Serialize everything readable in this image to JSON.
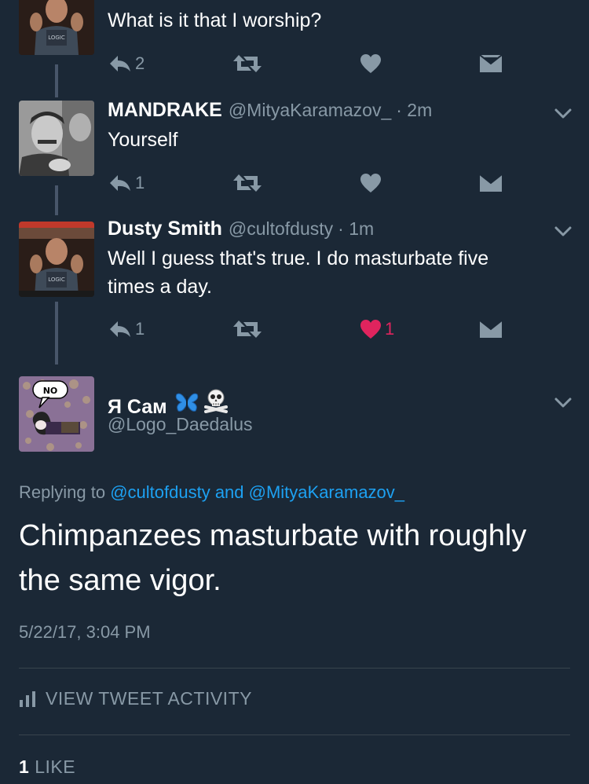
{
  "thread": {
    "first_tweet": {
      "text": "What is it that I worship?",
      "reply_count": "2"
    },
    "tweets": [
      {
        "display_name": "MANDRAKE",
        "handle": "@MityaKaramazov_",
        "time": "· 2m",
        "text_lines": [
          "Yourself"
        ],
        "reply_count": "1",
        "like_count": ""
      },
      {
        "display_name": "Dusty Smith",
        "handle": "@cultofdusty",
        "time": "· 1m",
        "text_lines": [
          "Well I guess that's true. I do masturbate five",
          "times a day."
        ],
        "reply_count": "1",
        "like_count": "1"
      }
    ]
  },
  "main_tweet": {
    "display_name": "Я Сам",
    "handle": "@Logo_Daedalus",
    "avatar_bubble_text": "NO",
    "replying_prefix": "Replying to",
    "reply_mentions": "@cultofdusty and @MityaKaramazov_",
    "text": "Chimpanzees masturbate with roughly the same vigor.",
    "timestamp": "5/22/17, 3:04 PM",
    "activity_label": "VIEW TWEET ACTIVITY",
    "like_count": "1",
    "like_label": "LIKE"
  },
  "icons": {
    "reply": "reply-icon",
    "retweet": "retweet-icon",
    "like": "heart-icon",
    "dm": "envelope-icon",
    "more": "chevron-down-icon",
    "activity": "bar-chart-icon",
    "butterfly": "butterfly-emoji",
    "skull": "skull-crossbones-emoji"
  },
  "colors": {
    "background": "#1b2836",
    "icon": "#8899a6",
    "mention": "#1da1f2",
    "liked": "#e0245e",
    "divider": "#38444d"
  }
}
